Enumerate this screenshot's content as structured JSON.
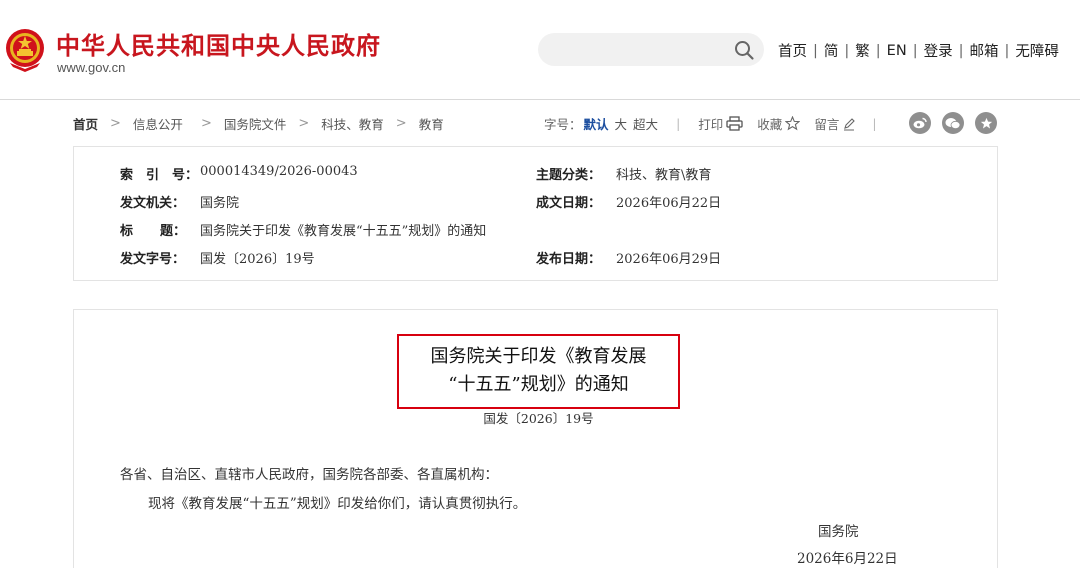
{
  "header": {
    "site_title": "中华人民共和国中央人民政府",
    "site_url": "www.gov.cn",
    "search_placeholder": "",
    "nav": [
      {
        "label": "首页"
      },
      {
        "label": "简"
      },
      {
        "label": "繁"
      },
      {
        "label": "EN"
      },
      {
        "label": "登录"
      },
      {
        "label": "邮箱"
      },
      {
        "label": "无障碍"
      }
    ],
    "nav_separator": "|"
  },
  "breadcrumb": {
    "items": [
      "首页",
      "信息公开",
      "国务院文件",
      "科技、教育",
      "教育"
    ],
    "arrow": ">"
  },
  "tools": {
    "font_size_label": "字号：",
    "font_default": "默认",
    "font_large": "大",
    "font_xlarge": "超大",
    "separator": "|",
    "print": "打印",
    "favorite": "收藏",
    "comment": "留言"
  },
  "share": {
    "icons": [
      "weibo-icon",
      "wechat-icon",
      "star-icon"
    ]
  },
  "info": {
    "index_label": "索　引　号：",
    "index_value": "000014349/2026-00043",
    "category_label": "主题分类：",
    "category_value": "科技、教育\\教育",
    "issuer_label": "发文机关：",
    "issuer_value": "国务院",
    "created_label": "成文日期：",
    "created_value": "2026年06月22日",
    "title_label_a": "标",
    "title_label_b": "题：",
    "title_value": "国务院关于印发《教育发展“十五五”规划》的通知",
    "docno_label": "发文字号：",
    "docno_value": "国发〔2026〕19号",
    "published_label": "发布日期：",
    "published_value": "2026年06月29日"
  },
  "document": {
    "title_line1": "国务院关于印发《教育发展",
    "title_line2": "“十五五”规划》的通知",
    "number": "国发〔2026〕19号",
    "salutation": "各省、自治区、直辖市人民政府，国务院各部委、各直属机构：",
    "body": "现将《教育发展“十五五”规划》印发给你们，请认真贯彻执行。",
    "signature": "国务院",
    "date": "2026年6月22日"
  },
  "colors": {
    "brand_red": "#c8161e",
    "highlight_red": "#d7000f",
    "link_blue": "#1d4fa0"
  }
}
